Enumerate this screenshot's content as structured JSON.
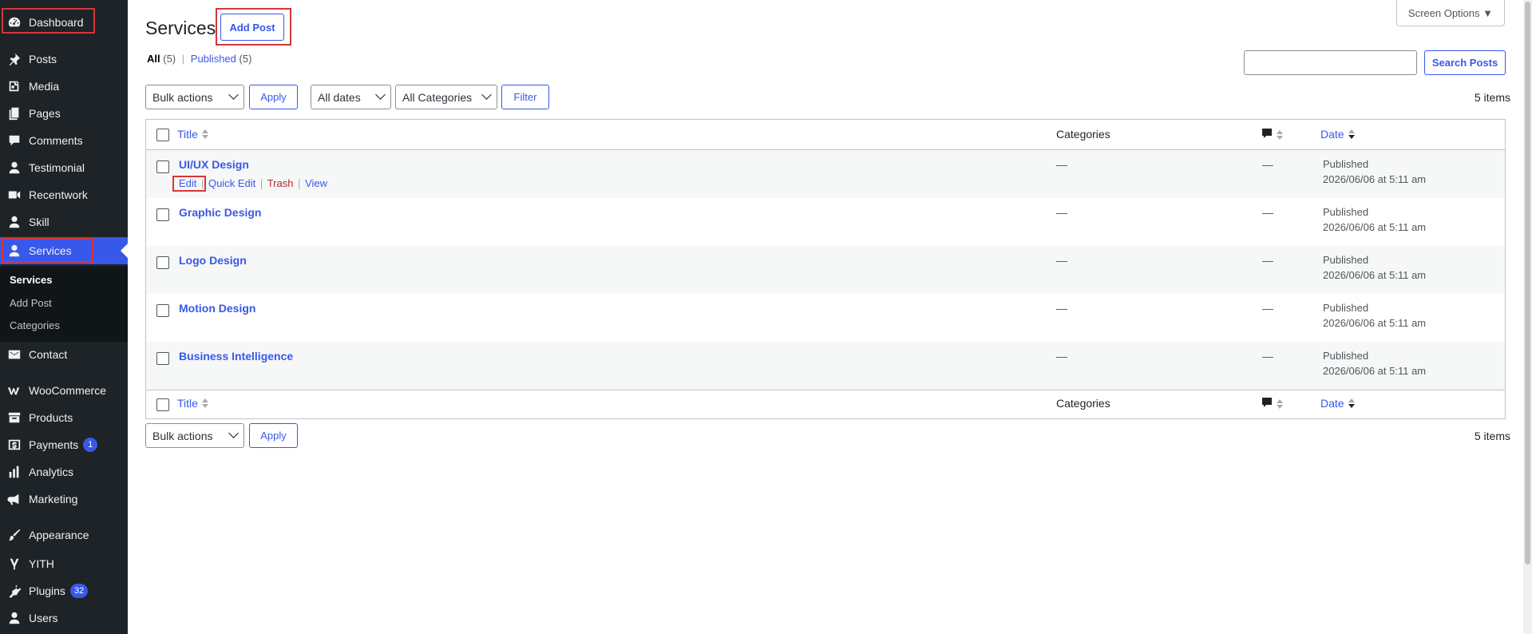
{
  "sidebar": {
    "items": [
      {
        "label": "Dashboard",
        "icon": "dashboard-icon"
      },
      {
        "label": "Posts",
        "icon": "pin-icon"
      },
      {
        "label": "Media",
        "icon": "media-icon"
      },
      {
        "label": "Pages",
        "icon": "pages-icon"
      },
      {
        "label": "Comments",
        "icon": "comments-icon"
      },
      {
        "label": "Testimonial",
        "icon": "person-icon"
      },
      {
        "label": "Recentwork",
        "icon": "video-icon"
      },
      {
        "label": "Skill",
        "icon": "person-icon"
      },
      {
        "label": "Services",
        "icon": "person-icon"
      },
      {
        "label": "Contact",
        "icon": "mail-icon"
      },
      {
        "label": "WooCommerce",
        "icon": "woocommerce-icon"
      },
      {
        "label": "Products",
        "icon": "archive-icon"
      },
      {
        "label": "Payments",
        "icon": "dollar-icon",
        "badge": "1"
      },
      {
        "label": "Analytics",
        "icon": "bar-chart-icon"
      },
      {
        "label": "Marketing",
        "icon": "megaphone-icon"
      },
      {
        "label": "Appearance",
        "icon": "brush-icon"
      },
      {
        "label": "YITH",
        "icon": "yith-icon"
      },
      {
        "label": "Plugins",
        "icon": "plugin-icon",
        "badge": "32"
      },
      {
        "label": "Users",
        "icon": "person-icon"
      }
    ],
    "submenu": [
      "Services",
      "Add Post",
      "Categories"
    ]
  },
  "header": {
    "title": "Services",
    "add_label": "Add Post",
    "screen_options": "Screen Options ▼"
  },
  "filters": {
    "all_label": "All",
    "all_count": "(5)",
    "separator": "|",
    "published_label": "Published",
    "published_count": "(5)",
    "search_button": "Search Posts",
    "bulk_actions": "Bulk actions",
    "apply": "Apply",
    "dates": "All dates",
    "categories": "All Categories",
    "filter": "Filter",
    "items_count": "5 items"
  },
  "table": {
    "columns": {
      "title": "Title",
      "categories": "Categories",
      "date": "Date"
    },
    "row_actions": {
      "edit": "Edit",
      "quick_edit": "Quick Edit",
      "trash": "Trash",
      "view": "View",
      "sep": "|"
    },
    "rows": [
      {
        "title": "UI/UX Design",
        "categories": "—",
        "comments": "—",
        "status": "Published",
        "date": "2026/06/06 at 5:11 am"
      },
      {
        "title": "Graphic Design",
        "categories": "—",
        "comments": "—",
        "status": "Published",
        "date": "2026/06/06 at 5:11 am"
      },
      {
        "title": "Logo Design",
        "categories": "—",
        "comments": "—",
        "status": "Published",
        "date": "2026/06/06 at 5:11 am"
      },
      {
        "title": "Motion Design",
        "categories": "—",
        "comments": "—",
        "status": "Published",
        "date": "2026/06/06 at 5:11 am"
      },
      {
        "title": "Business Intelligence",
        "categories": "—",
        "comments": "—",
        "status": "Published",
        "date": "2026/06/06 at 5:11 am"
      }
    ]
  },
  "colors": {
    "accent": "#3858e9",
    "sidebar_bg": "#1d2327",
    "highlight": "#d63638"
  }
}
